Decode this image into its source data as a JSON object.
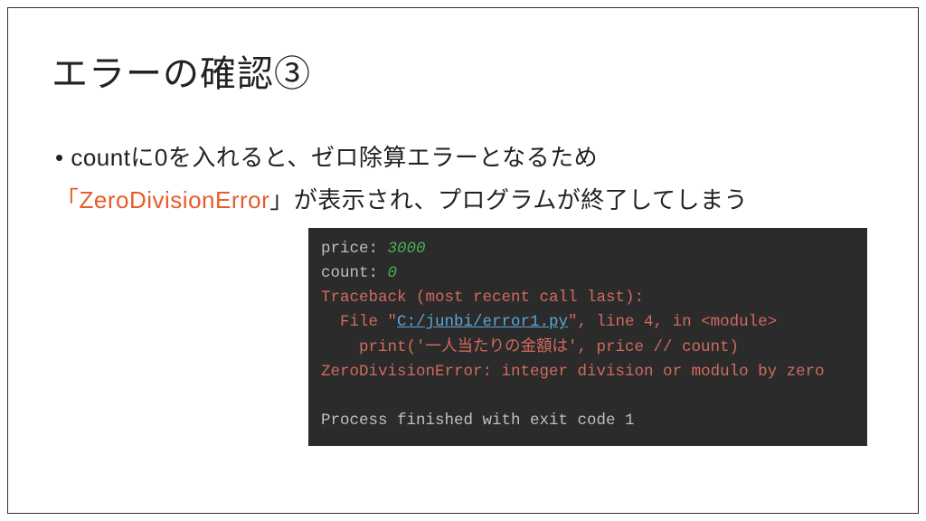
{
  "title": "エラーの確認③",
  "bullet": {
    "line1_prefix": "countに0を入れると、ゼロ除算エラーとなるため",
    "line2_quote_open": "「",
    "line2_highlight": "ZeroDivisionError",
    "line2_quote_close": "」が表示され、プログラムが終了してしまう"
  },
  "terminal": {
    "price_label": "price: ",
    "price_value": "3000",
    "count_label": "count: ",
    "count_value": "0",
    "traceback_header": "Traceback (most recent call last):",
    "file_prefix": "  File \"",
    "file_link": "C:/junbi/error1.py",
    "file_suffix": "\", line 4, in <module>",
    "print_line": "    print('一人当たりの金額は', price // count)",
    "error_line": "ZeroDivisionError: integer division or modulo by zero",
    "blank": "",
    "exit_line": "Process finished with exit code 1"
  }
}
